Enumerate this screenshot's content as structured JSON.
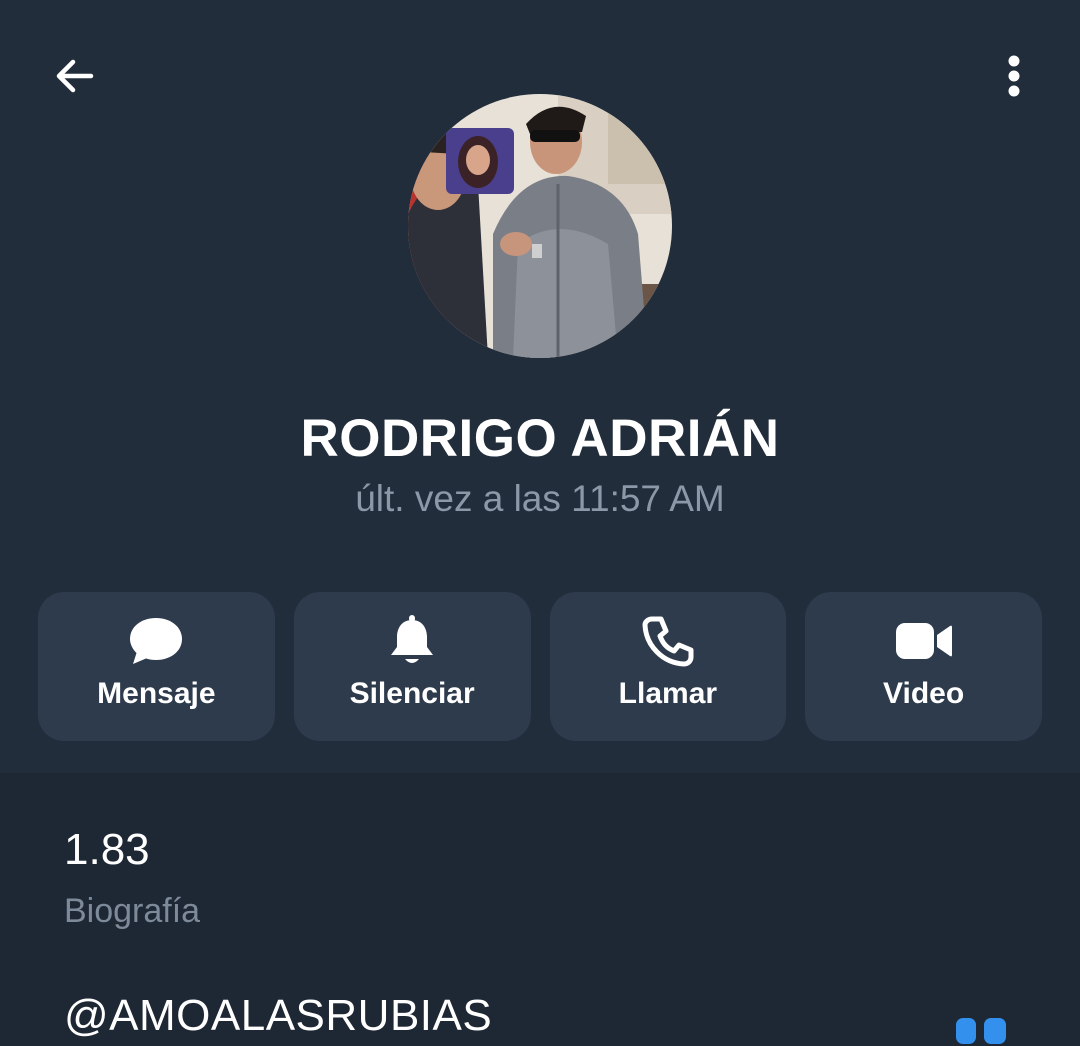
{
  "profile": {
    "name": "RODRIGO ADRIÁN",
    "status": "últ. vez a las 11:57 AM"
  },
  "actions": [
    {
      "label": "Mensaje",
      "icon": "chat-bubble-icon"
    },
    {
      "label": "Silenciar",
      "icon": "bell-icon"
    },
    {
      "label": "Llamar",
      "icon": "phone-icon"
    },
    {
      "label": "Video",
      "icon": "video-camera-icon"
    }
  ],
  "info": {
    "bio_value": "1.83",
    "bio_label": "Biografía",
    "username": "@AMOALASRUBIAS"
  },
  "colors": {
    "header_bg": "#222d3b",
    "body_bg": "#1e2734",
    "button_bg": "#2e3b4d",
    "muted_text": "#8b98a8",
    "accent": "#3390ec"
  }
}
